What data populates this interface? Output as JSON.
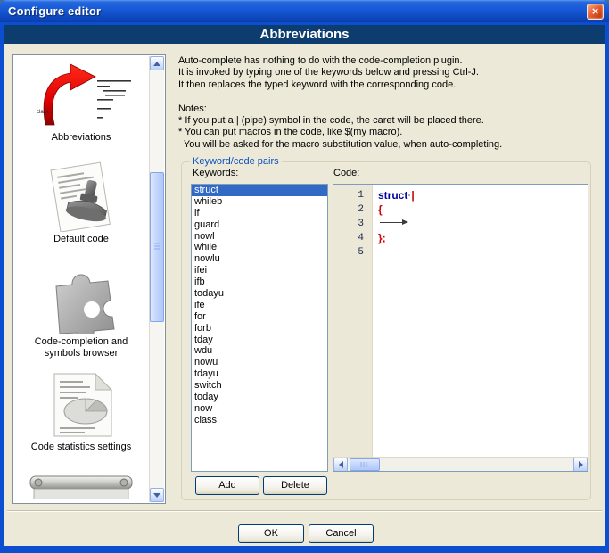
{
  "window": {
    "title": "Configure editor",
    "close_glyph": "×"
  },
  "page_header": {
    "title": "Abbreviations"
  },
  "intro_lines": [
    "Auto-complete has nothing to do with the code-completion plugin.",
    "It is invoked by typing one of the keywords below and pressing Ctrl-J.",
    "It then replaces the typed keyword with the corresponding code.",
    "",
    "Notes:",
    "* If you put a | (pipe) symbol in the code, the caret will be placed there.",
    "* You can put macros in the code, like $(my macro).",
    "  You will be asked for the macro substitution value, when auto-completing."
  ],
  "sidebar": {
    "items": [
      {
        "label": "Abbreviations",
        "icon": "abbreviations-icon"
      },
      {
        "label": "Default code",
        "icon": "default-code-icon"
      },
      {
        "label": "Code-completion and symbols browser",
        "icon": "puzzle-icon"
      },
      {
        "label": "Code statistics settings",
        "icon": "code-statistics-icon"
      },
      {
        "label": "",
        "icon": "toolbar-partial-icon"
      }
    ]
  },
  "keyword_group": {
    "title": "Keyword/code pairs",
    "keywords_label": "Keywords:",
    "code_label": "Code:",
    "selected_keyword": "struct",
    "keywords": [
      "struct",
      "whileb",
      "if",
      "guard",
      "nowl",
      "while",
      "nowlu",
      "ifei",
      "ifb",
      "todayu",
      "ife",
      "for",
      "forb",
      "tday",
      "wdu",
      "nowu",
      "tdayu",
      "switch",
      "today",
      "now",
      "class"
    ],
    "add_label": "Add",
    "delete_label": "Delete"
  },
  "code_editor": {
    "lines": [
      {
        "number": "1",
        "tokens": [
          {
            "text": "struct",
            "type": "keyword"
          },
          {
            "text": "·",
            "type": "ws"
          },
          {
            "text": "|",
            "type": "caret"
          }
        ]
      },
      {
        "number": "2",
        "tokens": [
          {
            "text": "{",
            "type": "symbol"
          }
        ]
      },
      {
        "number": "3",
        "tokens": [
          {
            "text": "",
            "type": "tab"
          }
        ]
      },
      {
        "number": "4",
        "tokens": [
          {
            "text": "};",
            "type": "symbol"
          }
        ]
      },
      {
        "number": "5",
        "tokens": []
      }
    ]
  },
  "footer": {
    "ok_label": "OK",
    "cancel_label": "Cancel"
  },
  "colors": {
    "selection": "#316ac5",
    "keyword": "#0000a0",
    "symbol": "#d40000",
    "header_bg": "#0d3c6e",
    "group_label": "#0a50bd",
    "client_bg": "#ece9d8"
  }
}
